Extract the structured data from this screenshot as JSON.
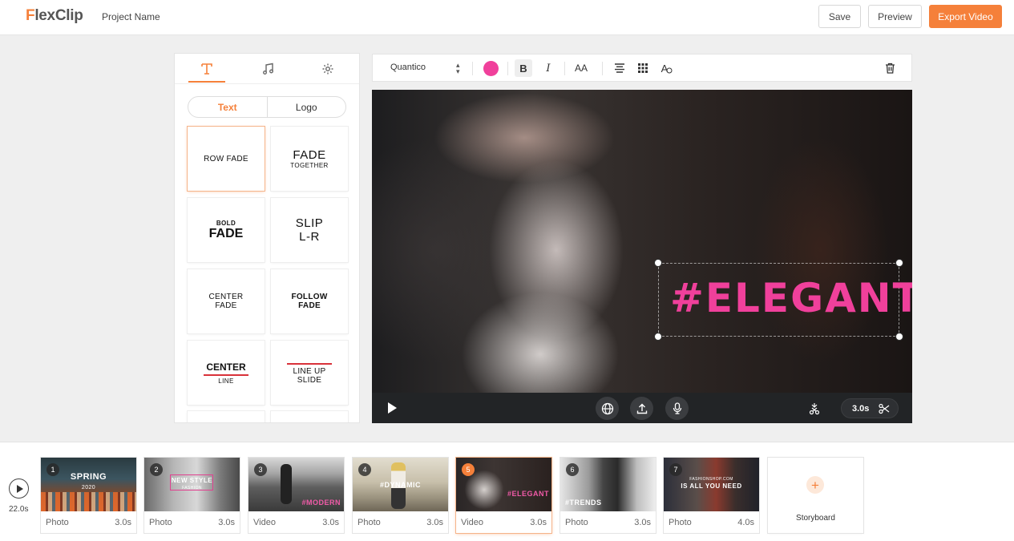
{
  "header": {
    "logo_prefix": "F",
    "logo_rest": "lexClip",
    "project_name": "Project Name",
    "save_label": "Save",
    "preview_label": "Preview",
    "export_label": "Export Video",
    "accent_color": "#f5803a"
  },
  "left_panel": {
    "tabs": [
      {
        "icon": "text-icon",
        "active": true
      },
      {
        "icon": "music-note-icon",
        "active": false
      },
      {
        "icon": "gear-icon",
        "active": false
      }
    ],
    "segments": {
      "text": "Text",
      "logo": "Logo",
      "active": "Text"
    },
    "tiles": {
      "row_fade": "ROW FADE",
      "fade_together_1": "FADE",
      "fade_together_2": "TOGETHER",
      "bold_fade_1": "BOLD",
      "bold_fade_2": "FADE",
      "slip_1": "SLIP",
      "slip_2": "L-R",
      "center_fade_1": "CENTER",
      "center_fade_2": "FADE",
      "follow_fade_1": "FOLLOW",
      "follow_fade_2": "FADE",
      "center_line_1": "CENTER",
      "center_line_2": "LINE",
      "line_up_1": "LINE UP",
      "line_up_2": "SLIDE"
    }
  },
  "toolbar": {
    "font": "Quantico",
    "text_color": "#f0409b",
    "bold_glyph": "B",
    "italic_glyph": "I",
    "size_glyph": "AA",
    "style_glyph": "A"
  },
  "canvas": {
    "text": "#ELEGANT",
    "duration": "3.0s"
  },
  "timeline": {
    "total": "22.0s",
    "clips": [
      {
        "num": "1",
        "type": "Photo",
        "dur": "3.0s",
        "title": "SPRING",
        "sub": "2020"
      },
      {
        "num": "2",
        "type": "Photo",
        "dur": "3.0s",
        "title": "NEW STYLE",
        "sub": "FASHION"
      },
      {
        "num": "3",
        "type": "Video",
        "dur": "3.0s",
        "title": "#MODERN",
        "sub": ""
      },
      {
        "num": "4",
        "type": "Photo",
        "dur": "3.0s",
        "title": "#DYNAMIC",
        "sub": ""
      },
      {
        "num": "5",
        "type": "Video",
        "dur": "3.0s",
        "title": "#ELEGANT",
        "sub": ""
      },
      {
        "num": "6",
        "type": "Photo",
        "dur": "3.0s",
        "title": "#TRENDS",
        "sub": ""
      },
      {
        "num": "7",
        "type": "Photo",
        "dur": "4.0s",
        "title": "IS ALL YOU NEED",
        "sub": "FASHIONSHOP.COM"
      }
    ],
    "storyboard_label": "Storyboard"
  }
}
